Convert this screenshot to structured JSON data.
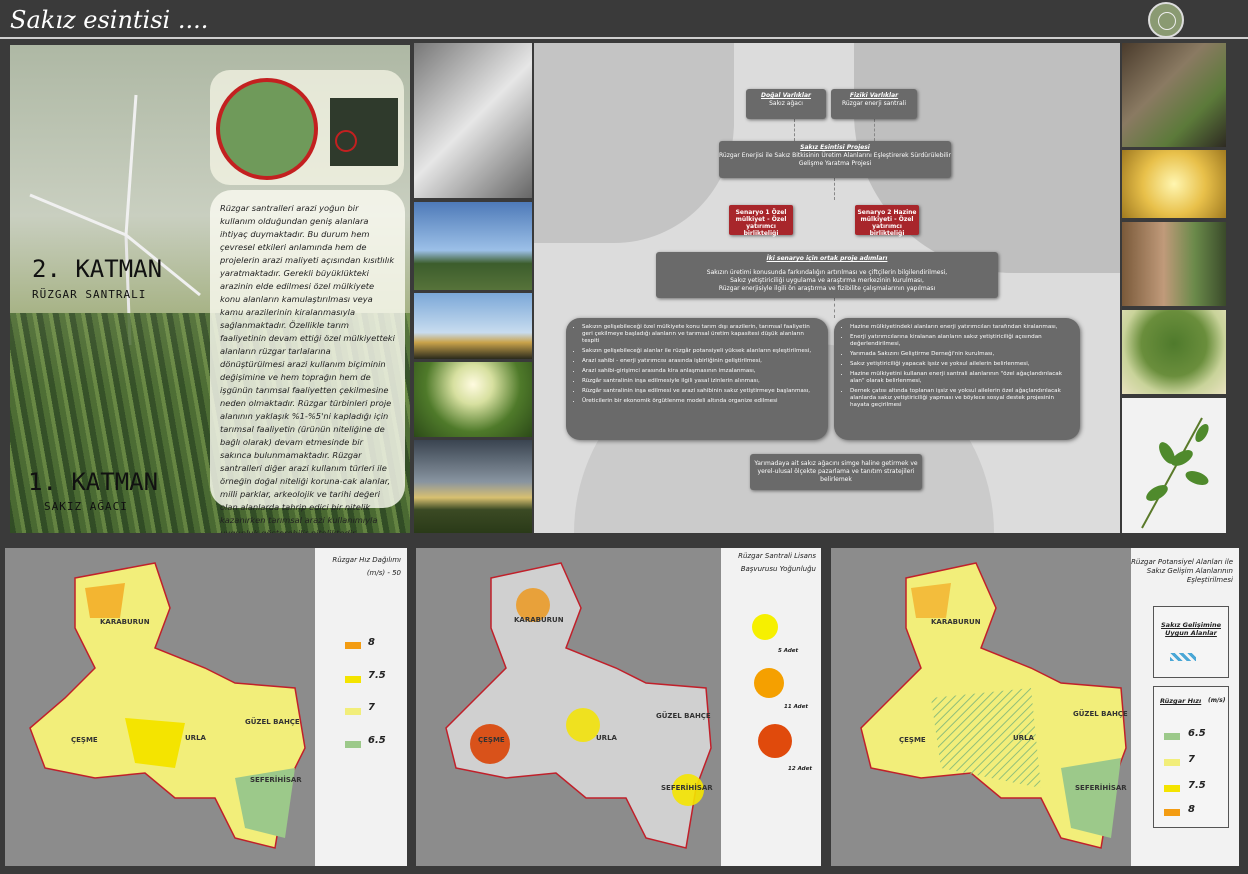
{
  "page": {
    "title": "Sakız esintisi ...."
  },
  "left": {
    "katman2_title": "2. KATMAN",
    "katman2_sub": "RÜZGAR SANTRALI",
    "katman1_title": "1. KATMAN",
    "katman1_sub": "SAKIZ AĞACI",
    "paragraph": "Rüzgar santralleri arazi yoğun bir kullanım olduğundan geniş alanlara ihtiyaç duymaktadır. Bu durum hem çevresel etkileri anlamında hem de projelerin arazi maliyeti açısından kısıtlılık yaratmaktadır. Gerekli büyüklükteki arazinin elde edilmesi özel mülkiyete konu alanların kamulaştırılması veya kamu arazilerinin kiralanmasıyla sağlanmaktadır. Özellikle tarım faaliyetinin devam ettiği özel mülkiyetteki alanların rüzgar tarlalarına dönüştürülmesi arazi kullanım biçiminin değişimine ve hem toprağın hem de işgünün tarımsal faaliyetten çekilmesine neden olmaktadır. Rüzgar türbinleri proje alanının yaklaşık %1-%5'ni kapladığı için tarımsal faaliyetin (ürünün niteliğine de bağlı olarak) devam etmesinde bir sakınca bulunmamaktadır. Rüzgar santralleri diğer arazi kullanım türleri ile örneğin doğal niteliği koruna-cak alanlar, milli parklar, arkeolojik ve tarihi değeri olan alanlarda tahrip edici bir nitelik kazanırken tarımsal arazi kullanımıyla uygunluk gösterebilir niteliktedir."
  },
  "diagram": {
    "dogal": {
      "title": "Doğal Varlıklar",
      "text": "Sakız ağacı"
    },
    "fiziki": {
      "title": "Fiziki Varlıklar",
      "text": "Rüzgar enerji santrali"
    },
    "proje": {
      "title": "Sakız Esintisi Projesi",
      "text": "Rüzgar Enerjisi ile Sakız Bitkisinin Üretim Alanlarını Eşleştirerek Sürdürülebilir Gelişme Yaratma Projesi"
    },
    "senaryo1": "Senaryo 1 Özel mülkiyet - Özel yatırımcı birlikteliği",
    "senaryo2": "Senaryo 2 Hazine mülkiyeti - Özel yatırımcı birlikteliği",
    "ortak": {
      "title": "İki senaryo için ortak proje adımları",
      "items": [
        "Sakızın üretimi konusunda farkındalığın artırılması ve çiftçilerin bilgilendirilmesi,",
        "Sakız yetiştiriciliği uygulama ve araştırma merkezinin kurulması,",
        "Rüzgar enerjisiyle ilgili ön araştırma ve fizibilite çalışmalarının yapılması"
      ]
    },
    "left_list": [
      "Sakızın gelişebileceği özel mülkiyete konu tarım dışı arazilerin, tarımsal faaliyetin geri çekilmeye başladığı alanların ve tarımsal üretim kapasitesi düşük alanların tespiti",
      "Sakızın gelişebileceği alanlar ile rüzgâr potansiyeli yüksek alanların eşleştirilmesi,",
      "Arazi sahibi - enerji yatırımcısı arasında işbirliğinin geliştirilmesi,",
      "Arazi sahibi-girişimci arasında kira anlaşmasının imzalanması,",
      "Rüzgâr santralinin inşa edilmesiyle ilgili yasal izinlerin alınması,",
      "Rüzgâr santralinin inşa edilmesi ve arazi sahibinin sakız yetiştirmeye başlanması,",
      "Üreticilerin bir ekonomik örgütlenme modeli altında organize edilmesi"
    ],
    "right_list": [
      "Hazine mülkiyetindeki alanların enerji yatırımcıları tarafından kiralanması,",
      "Enerji yatırımcılarına kiralanan alanların sakız yetiştiriciliği açısından değerlendirilmesi,",
      "Yarımada Sakızını Geliştirme Derneği'nin kurulması,",
      "Sakız yetiştiriciliği yapacak işsiz ve yoksul ailelerin belirlenmesi,",
      "Hazine mülkiyetini kullanan enerji santrali alanlarının \"özel ağaçlandırılacak alan\" olarak belirlenmesi,",
      "Dernek çatısı altında toplanan işsiz ve yoksul ailelerin özel ağaçlandırılacak alanlarda sakız yetiştiriciliği yapması ve böylece sosyal destek projesinin hayata geçirilmesi"
    ],
    "final": "Yarımadaya ait sakız ağacını simge haline getirmek ve yerel-ulusal ölçekte pazarlama ve tanıtım stratejileri belirlemek"
  },
  "map1": {
    "title1": "Rüzgar Hız Dağılımı",
    "title2": "(m/s) - 50",
    "legend": [
      {
        "label": "8",
        "color": "#f39c12"
      },
      {
        "label": "7.5",
        "color": "#f4e400"
      },
      {
        "label": "7",
        "color": "#f2ee7a"
      },
      {
        "label": "6.5",
        "color": "#9cc98a"
      }
    ]
  },
  "map2": {
    "title1": "Rüzgar Santrali Lisans",
    "title2": "Başvurusu Yoğunluğu",
    "legend": [
      {
        "label": "5 Adet",
        "color": "#f6f000"
      },
      {
        "label": "11 Adet",
        "color": "#f5a000"
      },
      {
        "label": "12 Adet",
        "color": "#e04a0c"
      }
    ]
  },
  "map3": {
    "title": "Rüzgar Potansiyel Alanları ile Sakız Gelişim Alanlarının Eşleştirilmesi",
    "box1_title": "Sakız Gelişimine Uygun Alanlar",
    "box2_title": "Rüzgar Hızı",
    "box2_unit": "(m/s)",
    "legend": [
      {
        "label": "6.5",
        "color": "#9cc98a"
      },
      {
        "label": "7",
        "color": "#f2ee7a"
      },
      {
        "label": "7.5",
        "color": "#f4e400"
      },
      {
        "label": "8",
        "color": "#f39c12"
      }
    ]
  },
  "cities": {
    "karaburun": "KARABURUN",
    "cesme": "ÇEŞME",
    "urla": "URLA",
    "guzel": "GÜZEL BAHÇE",
    "seferihisar": "SEFERİHİSAR"
  }
}
